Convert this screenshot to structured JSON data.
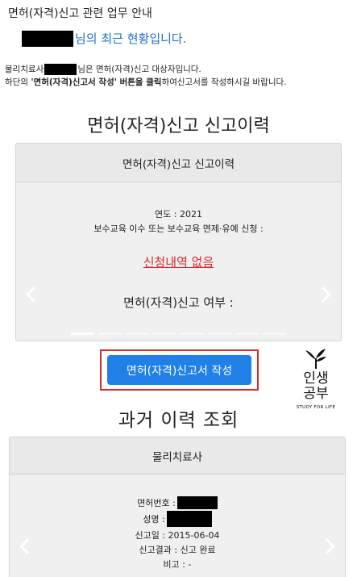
{
  "header": {
    "title": "면허(자격)신고 관련 업무 안내",
    "recent_suffix": "님의 최근 현황입니다."
  },
  "notice": {
    "prefix": "물리치료사",
    "middle": "님은 면허(자격)신고 대상자입니다.",
    "line2_start": "하단의 ",
    "line2_bold": "'면허(자격)신고서 작성' 버튼을 클릭",
    "line2_end": "하여신고서를 작성하시길 바랍니다."
  },
  "history_section": {
    "title": "면허(자격)신고 신고이력",
    "card_header": "면허(자격)신고 신고이력",
    "year_text": "연도 : 2021",
    "edu_text": "보수교육 이수 또는 보수교육 면제·유예 신청 :",
    "no_record": "신청내역 없음",
    "report_question": "면허(자격)신고 여부 :",
    "slide_count": 8,
    "active_slide": 0
  },
  "apply_button": {
    "label": "면허(자격)신고서 작성"
  },
  "logo": {
    "line1": "인생",
    "line2": "공부",
    "english": "STUDY FOR LIFE"
  },
  "past_section": {
    "title": "과거 이력 조회",
    "card_header": "물리치료사",
    "license_label": "면허번호 :",
    "name_label": "성명 :",
    "report_date": "신고일 : 2015-06-04",
    "report_result": "신고결과 : 신고 완료",
    "note": "비고 : -"
  },
  "colors": {
    "primary_blue": "#2080e8",
    "link_blue": "#1e6fd0",
    "alert_red": "#d9272e",
    "highlight_border": "#d42a2a",
    "card_bg": "#f0f0f0"
  }
}
